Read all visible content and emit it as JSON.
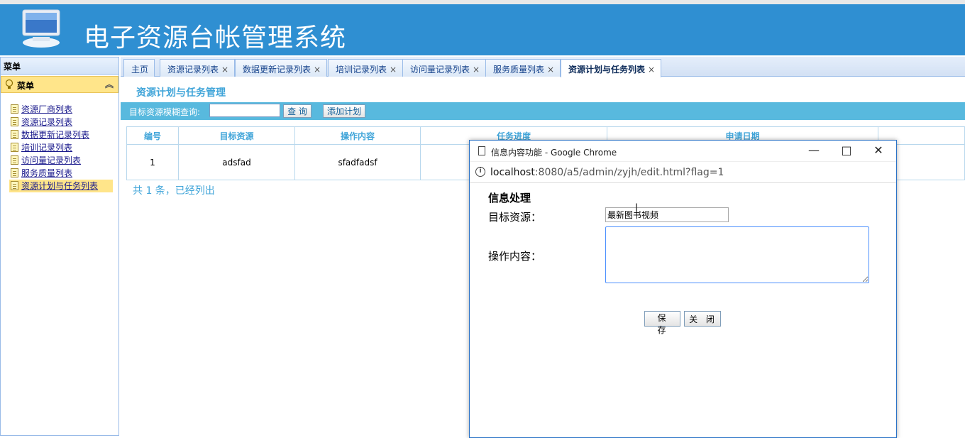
{
  "header": {
    "title": "电子资源台帐管理系统"
  },
  "sidebar": {
    "title": "菜单",
    "panel_title": "菜单",
    "items": [
      {
        "label": "资源厂商列表"
      },
      {
        "label": "资源记录列表"
      },
      {
        "label": "数据更新记录列表"
      },
      {
        "label": "培训记录列表"
      },
      {
        "label": "访问量记录列表"
      },
      {
        "label": "服务质量列表"
      },
      {
        "label": "资源计划与任务列表",
        "active": true
      }
    ]
  },
  "tabs": [
    {
      "label": "主页"
    },
    {
      "label": "资源记录列表",
      "close": "×"
    },
    {
      "label": "数据更新记录列表",
      "close": "×"
    },
    {
      "label": "培训记录列表",
      "close": "×"
    },
    {
      "label": "访问量记录列表",
      "close": "×"
    },
    {
      "label": "服务质量列表",
      "close": "×"
    },
    {
      "label": "资源计划与任务列表",
      "close": "×",
      "active": true
    }
  ],
  "main": {
    "page_title": "资源计划与任务管理",
    "search_label": "目标资源模糊查询:",
    "search_value": "",
    "query_button": "查 询",
    "add_button": "添加计划",
    "columns": [
      "编号",
      "目标资源",
      "操作内容",
      "任务进度",
      "申请日期"
    ],
    "rows": [
      {
        "id": "1",
        "target": "adsfad",
        "content": "sfadfadsf"
      }
    ],
    "footer": "共 1 条，已经列出"
  },
  "dialog": {
    "window_title": "信息内容功能 - Google Chrome",
    "url_host": "localhost",
    "url_rest": ":8080/a5/admin/zyjh/edit.html?flag=1",
    "heading": "信息处理",
    "target_label": "目标资源：",
    "target_value": "最新图书视频",
    "content_label": "操作内容：",
    "content_value": "",
    "save_button": "保 存",
    "close_button": "关 闭"
  },
  "colors": {
    "header_bg": "#2f8fd2",
    "accent": "#41a5d9",
    "searchbar_bg": "#58b9de",
    "menu_active": "#ffe58a"
  }
}
